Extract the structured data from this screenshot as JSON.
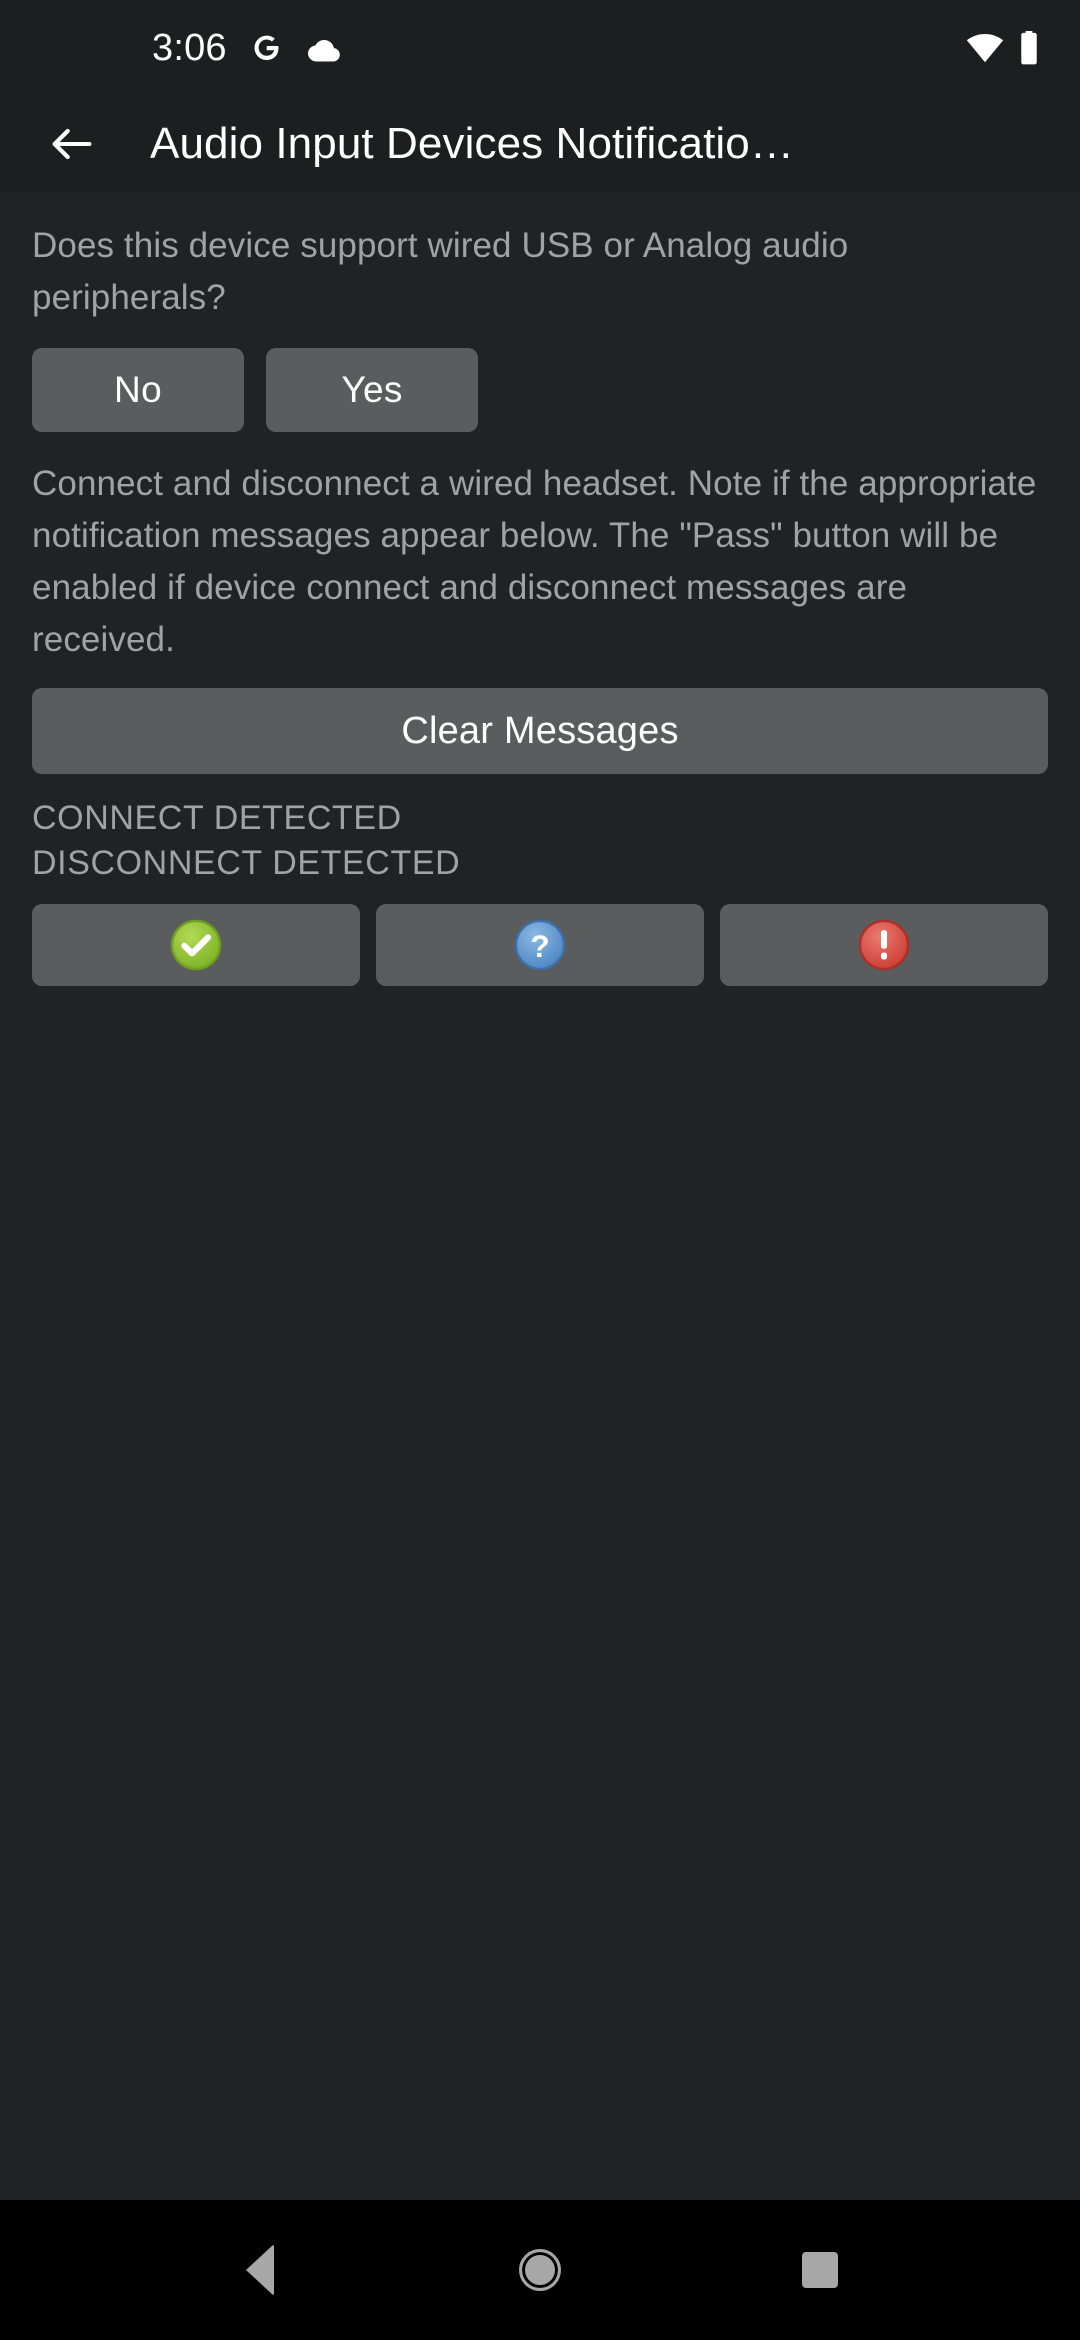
{
  "status_bar": {
    "time": "3:06",
    "icons": [
      "google-g-icon",
      "cloud-icon",
      "wifi-icon",
      "battery-icon"
    ]
  },
  "action_bar": {
    "back_icon": "arrow-back-icon",
    "title": "Audio Input Devices Notificatio…"
  },
  "main": {
    "support_question": "Does this device support wired USB or Analog audio peripherals?",
    "answer_no_label": "No",
    "answer_yes_label": "Yes",
    "instructions": "Connect and disconnect a wired headset. Note if the appropriate notification messages appear below. The \"Pass\" button will be enabled if device connect and disconnect messages are received.",
    "clear_messages_label": "Clear Messages",
    "status_lines": [
      "CONNECT DETECTED",
      "DISCONNECT DETECTED"
    ],
    "verdict_buttons": [
      {
        "name": "pass-button",
        "icon": "check-circle-icon",
        "color": "#8cc63f",
        "glyph": "✔"
      },
      {
        "name": "info-button",
        "icon": "question-circle-icon",
        "color": "#5b9bd5",
        "glyph": "?"
      },
      {
        "name": "fail-button",
        "icon": "exclamation-circle-icon",
        "color": "#d9534f",
        "glyph": "!"
      }
    ]
  },
  "nav_bar": {
    "back_label": "back-nav-icon",
    "home_label": "home-nav-icon",
    "recents_label": "recents-nav-icon"
  },
  "colors": {
    "background": "#1d1e20",
    "content_background": "#212225",
    "button_grey": "#5b5c5e",
    "text_primary": "#ffffff",
    "text_secondary": "#9fa2a6",
    "nav_background": "#000000",
    "nav_icon": "#a7a7a7"
  }
}
